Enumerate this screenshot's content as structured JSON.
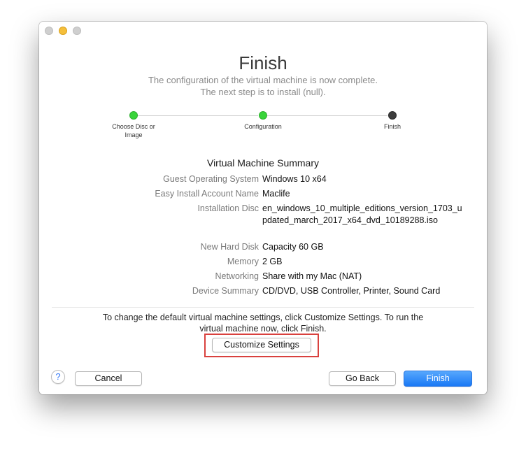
{
  "window": {
    "title": "Finish"
  },
  "subtitle": {
    "line1": "The configuration of the virtual machine is now complete.",
    "line2": "The next step is to install (null)."
  },
  "steps": [
    {
      "label_line1": "Choose Disc or",
      "label_line2": "Image",
      "status": "complete"
    },
    {
      "label_line1": "Configuration",
      "label_line2": "",
      "status": "complete"
    },
    {
      "label_line1": "Finish",
      "label_line2": "",
      "status": "current"
    }
  ],
  "summary": {
    "title": "Virtual Machine Summary",
    "rows": [
      {
        "label": "Guest Operating System",
        "value": "Windows 10 x64"
      },
      {
        "label": "Easy Install Account Name",
        "value": "Maclife"
      },
      {
        "label": "Installation Disc",
        "value_line1": "en_windows_10_multiple_editions_version_1703_u",
        "value_line2": "pdated_march_2017_x64_dvd_10189288.iso"
      },
      {
        "label": "New Hard Disk",
        "value": "Capacity 60 GB"
      },
      {
        "label": "Memory",
        "value": "2 GB"
      },
      {
        "label": "Networking",
        "value": "Share with my Mac (NAT)"
      },
      {
        "label": "Device Summary",
        "value": "CD/DVD, USB Controller, Printer, Sound Card"
      }
    ]
  },
  "info": {
    "line1": "To change the default virtual machine settings, click Customize Settings. To run the",
    "line2": "virtual machine now, click Finish."
  },
  "buttons": {
    "customize": "Customize Settings",
    "help": "?",
    "cancel": "Cancel",
    "go_back": "Go Back",
    "finish": "Finish"
  },
  "colors": {
    "step_complete": "#39d43a",
    "step_current": "#3d3d3d",
    "highlight_border": "#d9413e",
    "primary_button": "#1a79f5"
  }
}
